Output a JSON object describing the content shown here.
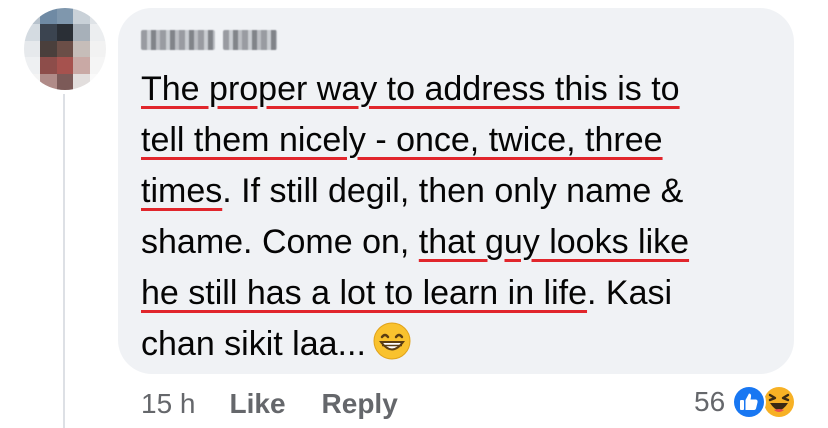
{
  "comment": {
    "author": "",
    "lines": [
      [
        {
          "text": "The proper way to address this is to",
          "underline": true
        }
      ],
      [
        {
          "text": "tell them nicely - once, twice, three",
          "underline": true
        }
      ],
      [
        {
          "text": "times",
          "underline": true
        },
        {
          "text": ". If still degil, then only name &",
          "underline": false
        }
      ],
      [
        {
          "text": "shame. Come on, ",
          "underline": false
        },
        {
          "text": "that guy looks like",
          "underline": true
        }
      ],
      [
        {
          "text": "he still has a lot to learn in life",
          "underline": true
        },
        {
          "text": ". Kasi",
          "underline": false
        }
      ],
      [
        {
          "text": "chan sikit laa...",
          "underline": false
        }
      ]
    ],
    "trailing_emoji": "grinning-face-with-smiling-eyes"
  },
  "footer": {
    "time": "15 h",
    "like_label": "Like",
    "reply_label": "Reply"
  },
  "reactions": {
    "count": "56",
    "icons": [
      "like-icon",
      "haha-icon"
    ]
  },
  "colors": {
    "bubble": "#f0f2f5",
    "text": "#050505",
    "meta": "#65676b",
    "annotation_underline": "#e1262c",
    "like_blue": "#1877f2",
    "haha_yellow": "#f7b125"
  }
}
